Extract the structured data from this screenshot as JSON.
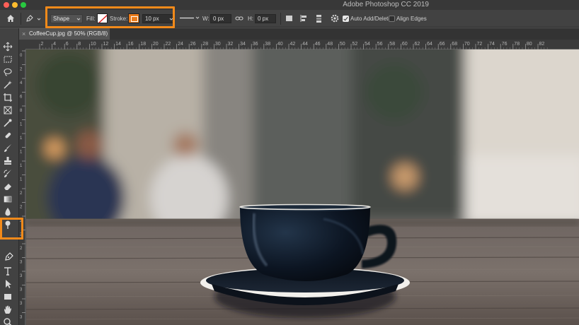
{
  "window": {
    "title": "Adobe Photoshop CC 2019"
  },
  "options_bar": {
    "mode_value": "Shape",
    "fill_label": "Fill:",
    "stroke_label": "Stroke:",
    "stroke_width_value": "10 px",
    "w_label": "W:",
    "w_value": "0 px",
    "h_label": "H:",
    "h_value": "0 px",
    "auto_add_delete_label": "Auto Add/Delete",
    "auto_add_delete_checked": true,
    "align_edges_label": "Align Edges",
    "align_edges_checked": false,
    "stroke_color": "#ea7c1c",
    "highlight_color": "#f28a1a"
  },
  "document_tab": {
    "label": "CoffeeCup.jpg @ 50% (RGB/8)",
    "close_label": "×"
  },
  "ruler": {
    "h_ticks": [
      "2",
      "4",
      "6",
      "8",
      "10",
      "12",
      "14",
      "16",
      "18",
      "20",
      "22",
      "24",
      "26",
      "28",
      "30",
      "32",
      "34",
      "36",
      "38",
      "40",
      "42",
      "44",
      "46",
      "48",
      "50",
      "52",
      "54",
      "56",
      "58",
      "60",
      "62",
      "64",
      "66",
      "68",
      "70",
      "72",
      "74",
      "76",
      "78",
      "80",
      "82"
    ],
    "v_ticks": [
      "0",
      "2",
      "4",
      "6",
      "8",
      "10",
      "12",
      "14",
      "16",
      "18",
      "20",
      "22",
      "24",
      "26",
      "28",
      "30",
      "32",
      "34",
      "36",
      "38"
    ]
  },
  "toolbar": {
    "tools": [
      "move-tool",
      "marquee-tool",
      "lasso-tool",
      "magic-wand-tool",
      "crop-tool",
      "frame-tool",
      "eyedropper-tool",
      "healing-brush-tool",
      "brush-tool",
      "clone-stamp-tool",
      "history-brush-tool",
      "eraser-tool",
      "gradient-tool",
      "blur-tool",
      "dodge-tool",
      "pen-tool",
      "type-tool",
      "path-selection-tool",
      "rectangle-tool",
      "hand-tool",
      "zoom-tool",
      "more-tools",
      "color-swatches"
    ],
    "active_tool": "pen-tool"
  }
}
